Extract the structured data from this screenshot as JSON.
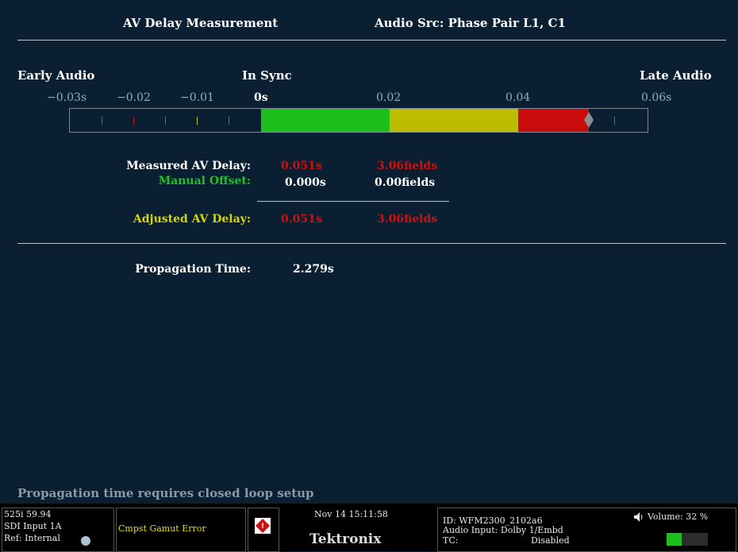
{
  "header": {
    "title": "AV Delay Measurement",
    "audio_src": "Audio Src: Phase Pair  L1, C1"
  },
  "meter": {
    "early_label": "Early Audio",
    "sync_label": "In Sync",
    "late_label": "Late Audio",
    "scale": [
      "−0.03s",
      "−0.02",
      "−0.01",
      "0s",
      "0.02",
      "0.04",
      "0.06s"
    ],
    "range_s": [
      -0.03,
      0.06
    ],
    "indicator_value_s": 0.051,
    "colors": {
      "green": "#1cbf1c",
      "yellow": "#bcbc00",
      "red": "#c80b0b",
      "indicator": "#8c8c8c"
    },
    "zones": [
      {
        "from": 0.0,
        "to": 0.02,
        "color": "green"
      },
      {
        "from": 0.02,
        "to": 0.04,
        "color": "yellow"
      },
      {
        "from": 0.04,
        "to": 0.051,
        "color": "red"
      }
    ]
  },
  "measurements": {
    "measured_label": "Measured AV Delay:",
    "measured_s": "0.051s",
    "measured_fields": "3.06fields",
    "manual_label": "Manual Offset:",
    "manual_s": "0.000s",
    "manual_fields": "0.00fields",
    "adjusted_label": "Adjusted AV Delay:",
    "adjusted_s": "0.051s",
    "adjusted_fields": "3.06fields",
    "colors": {
      "measured_value": "#cc1111",
      "manual_label": "#22c022",
      "adjusted_label": "#d6d600"
    }
  },
  "propagation": {
    "label": "Propagation Time:",
    "value": "2.279s",
    "note": "Propagation time requires closed loop setup"
  },
  "status_bar": {
    "format": "525i 59.94",
    "input": "SDI Input 1A",
    "ref": "Ref: Internal",
    "error": "Cmpst Gamut Error",
    "datetime": "Nov 14 15:11:58",
    "brand": "Tektronix",
    "id": "ID: WFM2300_2102a6",
    "audio_input": "Audio Input: Dolby 1/Embd",
    "tc_label": "TC:",
    "tc_value": "Disabled",
    "volume": "Volume:  32 %",
    "volume_fraction": 0.32
  }
}
